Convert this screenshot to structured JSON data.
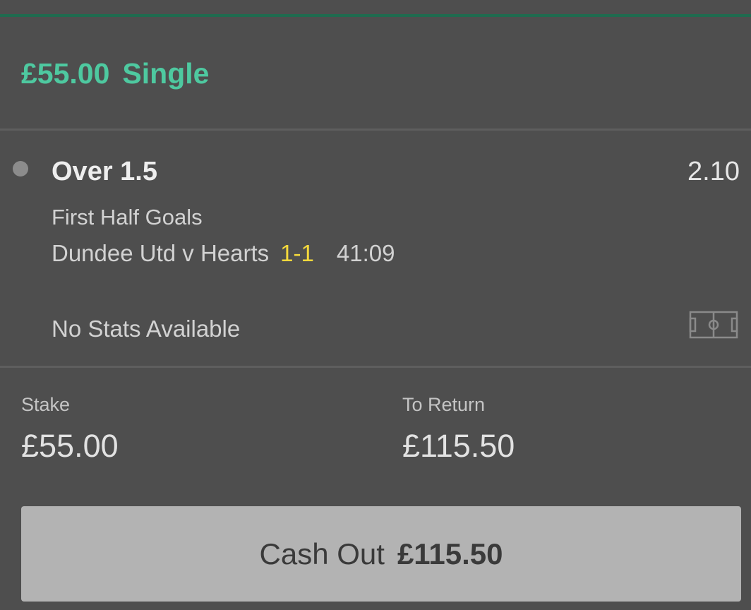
{
  "bet": {
    "amount": "£55.00",
    "type": "Single"
  },
  "selection": {
    "name": "Over 1.5",
    "odds": "2.10",
    "market": "First Half Goals",
    "event": "Dundee Utd v Hearts",
    "score": "1-1",
    "clock": "41:09",
    "stats_text": "No Stats Available",
    "pitch_icon": "football-pitch-icon"
  },
  "summary": {
    "stake_label": "Stake",
    "stake_value": "£55.00",
    "return_label": "To Return",
    "return_value": "£115.50"
  },
  "cashout": {
    "label": "Cash Out",
    "amount": "£115.50"
  },
  "colors": {
    "accent": "#4ec9a0",
    "score": "#f4d93c",
    "background": "#4e4e4e",
    "button": "#b3b3b3"
  }
}
